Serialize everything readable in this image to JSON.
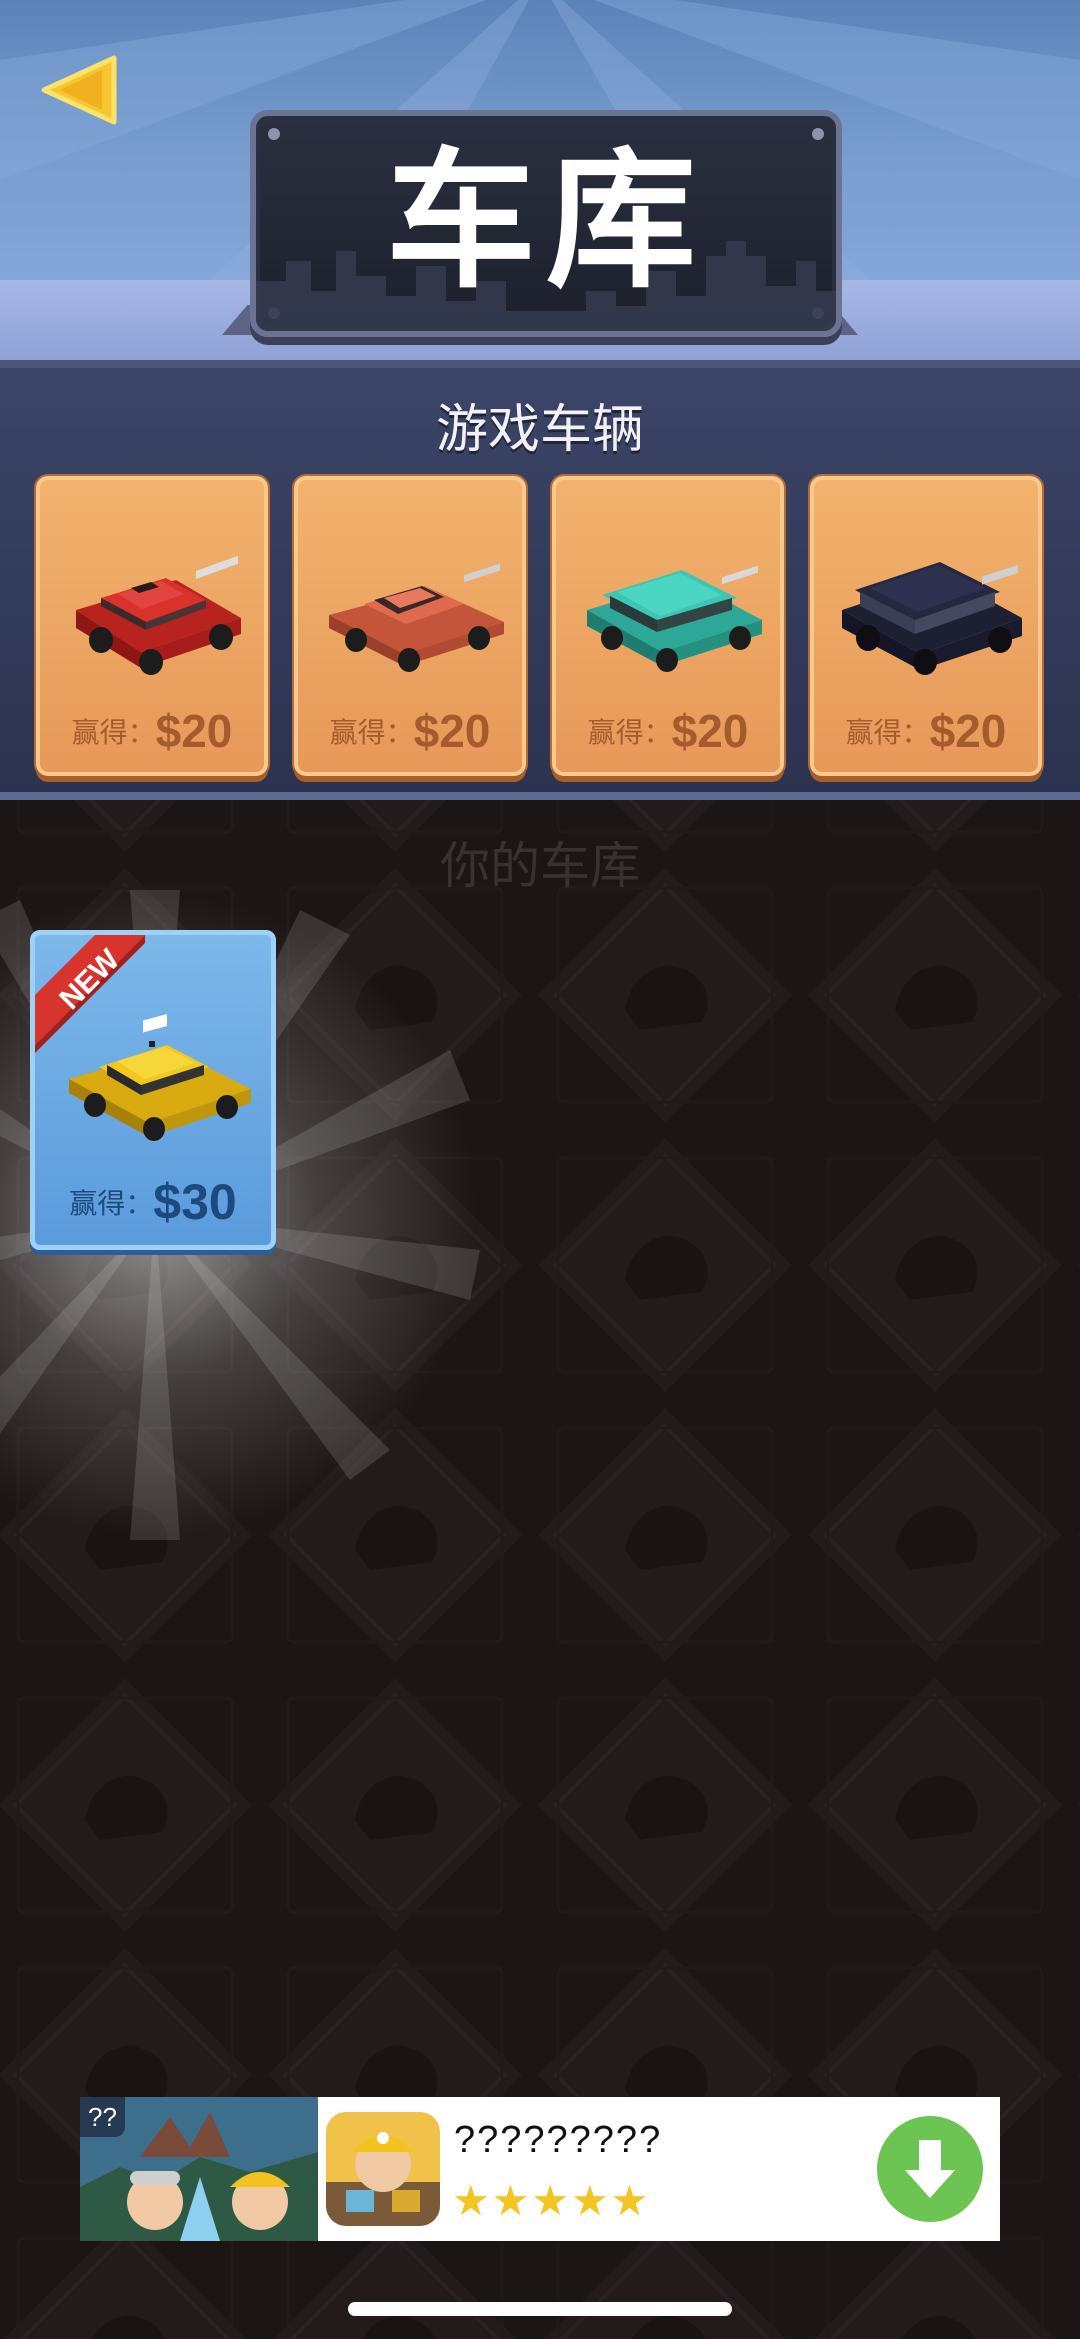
{
  "header": {
    "title": "车库",
    "back_icon": "back-arrow-icon"
  },
  "game_vehicles": {
    "title": "游戏车辆",
    "cards": [
      {
        "car": "red-hatchback",
        "color": "#d9312c",
        "earn_label": "赢得：",
        "price": "$20"
      },
      {
        "car": "coral-sedan",
        "color": "#e06a4d",
        "earn_label": "赢得：",
        "price": "$20"
      },
      {
        "car": "teal-wagon",
        "color": "#3cc6b4",
        "earn_label": "赢得：",
        "price": "$20"
      },
      {
        "car": "navy-suv",
        "color": "#262840",
        "earn_label": "赢得：",
        "price": "$20"
      }
    ]
  },
  "your_garage": {
    "title": "你的车库",
    "cards": [
      {
        "car": "yellow-taxi",
        "color": "#f2c81f",
        "badge": "NEW",
        "earn_label": "赢得：",
        "price": "$30"
      }
    ]
  },
  "ad": {
    "badge": "??",
    "title": "?????????",
    "rating_stars": 5,
    "download_icon": "download-arrow-icon"
  },
  "colors": {
    "vehicle_card": "#eda565",
    "owned_card": "#6aa9e3",
    "download_button": "#6cc452",
    "star": "#f2c522"
  }
}
